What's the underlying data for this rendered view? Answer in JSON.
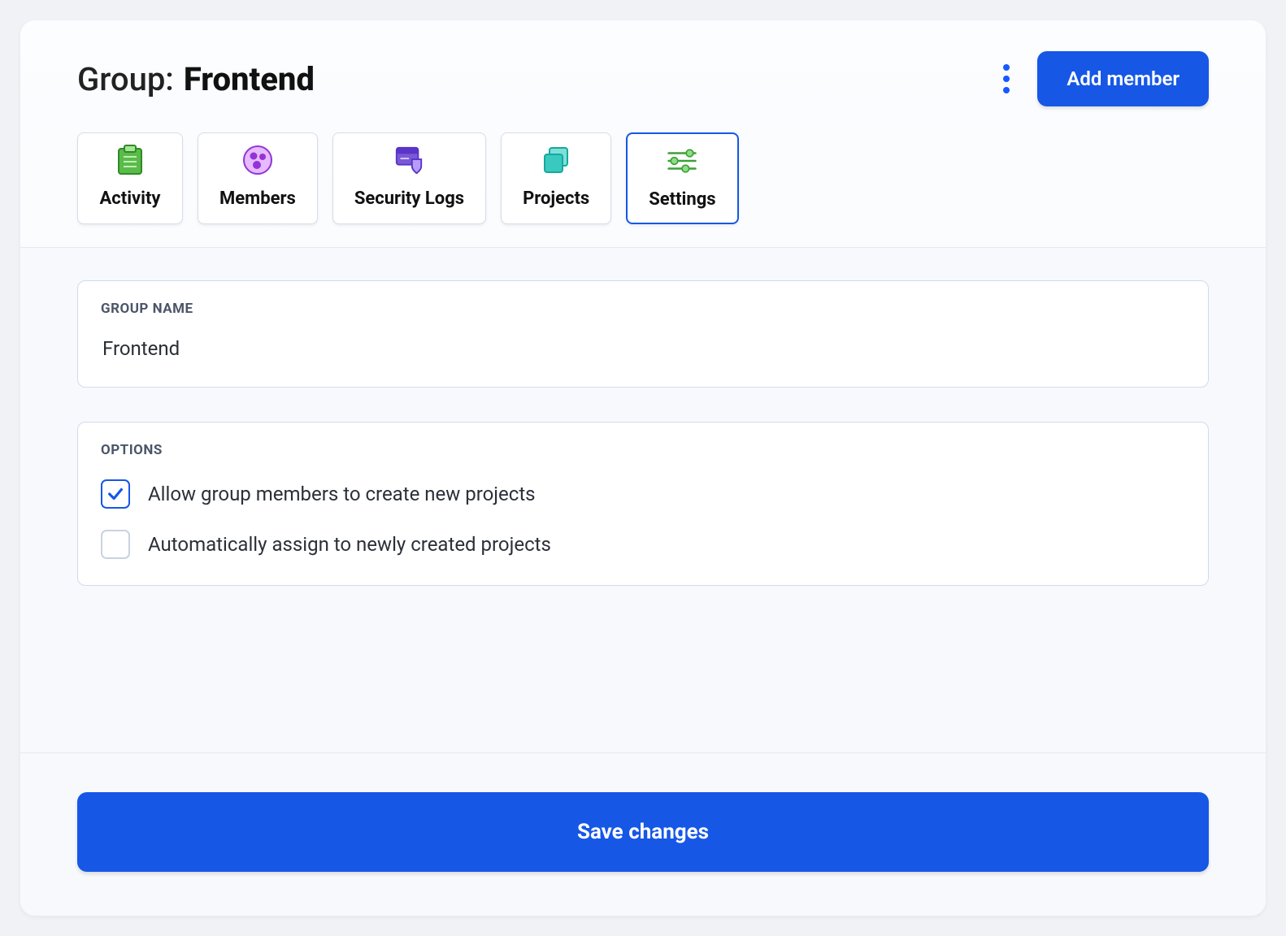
{
  "header": {
    "title_prefix": "Group:",
    "title_name": "Frontend",
    "add_member_label": "Add member"
  },
  "tabs": [
    {
      "label": "Activity",
      "icon": "clipboard-icon"
    },
    {
      "label": "Members",
      "icon": "people-icon"
    },
    {
      "label": "Security Logs",
      "icon": "shield-icon"
    },
    {
      "label": "Projects",
      "icon": "folders-icon"
    },
    {
      "label": "Settings",
      "icon": "sliders-icon"
    }
  ],
  "active_tab": "Settings",
  "settings": {
    "group_name_label": "GROUP NAME",
    "group_name_value": "Frontend",
    "options_label": "OPTIONS",
    "options": [
      {
        "label": "Allow group members to create new projects",
        "checked": true
      },
      {
        "label": "Automatically assign to newly created projects",
        "checked": false
      }
    ]
  },
  "footer": {
    "save_label": "Save changes"
  }
}
